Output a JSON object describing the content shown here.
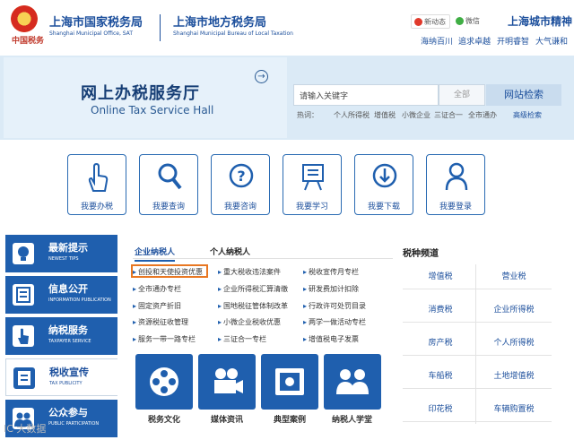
{
  "header": {
    "tagline": "中国税务",
    "org1": {
      "title": "上海市国家税务局",
      "sub": "Shanghai Municipal Office, SAT"
    },
    "org2": {
      "title": "上海市地方税务局",
      "sub": "Shanghai Municipal Bureau of Local Taxation"
    },
    "weibo_label": "新动态",
    "wechat_label": "微信",
    "spirit_title": "上海城市精神",
    "spirit_words": [
      "海纳百川",
      "追求卓越",
      "开明睿智",
      "大气谦和"
    ]
  },
  "banner": {
    "title": "网上办税服务厅",
    "subtitle": "Online Tax Service Hall",
    "arrow": "→",
    "search": {
      "placeholder": "请输入关键字",
      "scope": "全部",
      "button": "网站检索"
    },
    "hot": {
      "label": "热词：",
      "words": [
        "个人所得税",
        "增值税",
        "小微企业",
        "三证合一",
        "全市通办"
      ],
      "advanced": "高级检索"
    }
  },
  "quick": [
    {
      "label": "我要办税",
      "icon": "hand-icon"
    },
    {
      "label": "我要查询",
      "icon": "search-icon"
    },
    {
      "label": "我要咨询",
      "icon": "question-icon"
    },
    {
      "label": "我要学习",
      "icon": "easel-icon"
    },
    {
      "label": "我要下载",
      "icon": "download-icon"
    },
    {
      "label": "我要登录",
      "icon": "user-icon"
    }
  ],
  "side": [
    {
      "title": "最新提示",
      "sub": "NEWEST TIPS"
    },
    {
      "title": "信息公开",
      "sub": "INFORMATION PUBLICATION"
    },
    {
      "title": "纳税服务",
      "sub": "TAXPAYER SERVICE"
    },
    {
      "title": "税收宣传",
      "sub": "TAX PUBLICITY"
    },
    {
      "title": "公众参与",
      "sub": "PUBLIC PARTICIPATION"
    }
  ],
  "tabs": [
    "企业纳税人",
    "个人纳税人"
  ],
  "links": [
    [
      "创投和天使投资优惠",
      "重大税收违法案件",
      "税收宣传月专栏"
    ],
    [
      "全市通办专栏",
      "企业所得税汇算清缴",
      "研发费加计扣除"
    ],
    [
      "固定资产折旧",
      "国地税征管体制改革",
      "行政许可处罚目录"
    ],
    [
      "资源税征收管理",
      "小微企业税收优惠",
      "两学一做活动专栏"
    ],
    [
      "服务一带一路专栏",
      "三证合一专栏",
      "增值税电子发票"
    ]
  ],
  "cards": [
    {
      "label": "税务文化",
      "icon": "film-reel-icon"
    },
    {
      "label": "媒体资讯",
      "icon": "video-camera-icon"
    },
    {
      "label": "典型案例",
      "icon": "safe-icon"
    },
    {
      "label": "纳税人学堂",
      "icon": "students-icon"
    }
  ],
  "tax_channel": {
    "title": "税种频道",
    "items": [
      [
        "增值税",
        "营业税"
      ],
      [
        "消费税",
        "企业所得税"
      ],
      [
        "房产税",
        "个人所得税"
      ],
      [
        "车船税",
        "土地增值税"
      ],
      [
        "印花税",
        "车辆购置税"
      ]
    ]
  },
  "watermark": "IC 大数据",
  "colors": {
    "brand": "#1f5fae",
    "highlight": "#e87722",
    "banner": "#dbeaf6"
  }
}
